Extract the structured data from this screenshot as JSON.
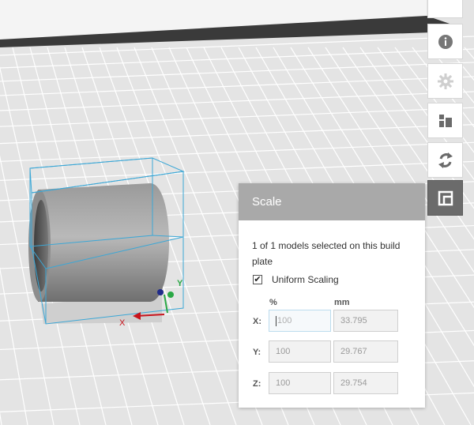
{
  "toolbar": {
    "buttons": [
      {
        "name": "info",
        "icon": "info-icon"
      },
      {
        "name": "settings",
        "icon": "gear-icon"
      },
      {
        "name": "arrange",
        "icon": "arrange-icon"
      },
      {
        "name": "rotate",
        "icon": "rotate-icon"
      },
      {
        "name": "scale",
        "icon": "scale-icon",
        "active": true
      }
    ]
  },
  "scene": {
    "axis_x": "X",
    "axis_y": "Y",
    "model": "cylinder",
    "colors": {
      "grid": "#ffffff",
      "floor": "#e4e4e4",
      "bbox": "#3ba7d6",
      "axis_x": "#c8141c",
      "axis_y": "#2aa845",
      "axis_z": "#1f2a8a"
    }
  },
  "scale_panel": {
    "title": "Scale",
    "description": "1 of 1 models selected on this build plate",
    "uniform_scaling_label": "Uniform Scaling",
    "uniform_scaling_checked": "✔",
    "col_percent": "%",
    "col_mm": "mm",
    "rows": [
      {
        "axis": "X:",
        "percent": "100",
        "mm": "33.795"
      },
      {
        "axis": "Y:",
        "percent": "100",
        "mm": "29.767"
      },
      {
        "axis": "Z:",
        "percent": "100",
        "mm": "29.754"
      }
    ]
  }
}
